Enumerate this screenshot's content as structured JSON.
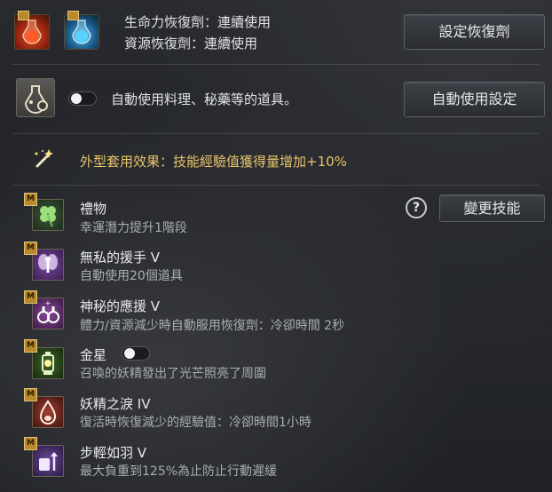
{
  "recovery": {
    "hp_potion_label": "生命力恢復劑：連續使用",
    "resource_potion_label": "資源恢復劑：連續使用",
    "settings_button": "設定恢復劑"
  },
  "auto_use": {
    "toggle_on": false,
    "label": "自動使用料理、秘藥等的道具。",
    "settings_button": "自動使用設定"
  },
  "costume_effect": {
    "label": "外型套用效果：技能經驗值獲得量增加+10%"
  },
  "skills_header": {
    "help_symbol": "?",
    "change_button": "變更技能"
  },
  "skills": [
    {
      "badge": "M",
      "name": "禮物",
      "desc": "幸運潛力提升1階段",
      "icon": "clover-icon"
    },
    {
      "badge": "M",
      "name": "無私的援手 V",
      "desc": "自動使用20個道具",
      "icon": "fairy-icon"
    },
    {
      "badge": "M",
      "name": "神秘的應援 V",
      "desc": "體力/資源減少時自動服用恢復劑：冷卻時間 2秒",
      "icon": "potions-icon"
    },
    {
      "badge": "M",
      "name": "金星",
      "desc": "召喚的妖精發出了光芒照亮了周圍",
      "icon": "lantern-icon",
      "toggle_on": false
    },
    {
      "badge": "M",
      "name": "妖精之淚 IV",
      "desc": "復活時恢復減少的經驗值：冷卻時間1小時",
      "icon": "tear-icon"
    },
    {
      "badge": "M",
      "name": "步輕如羽 V",
      "desc": "最大負重到125%為止防止行動遲緩",
      "icon": "feather-weight-icon"
    }
  ],
  "colors": {
    "accent_gold": "#e8c46a",
    "badge_gold": "#b88a2c",
    "text_primary": "#e8eaee",
    "text_secondary": "#a9adb4"
  }
}
